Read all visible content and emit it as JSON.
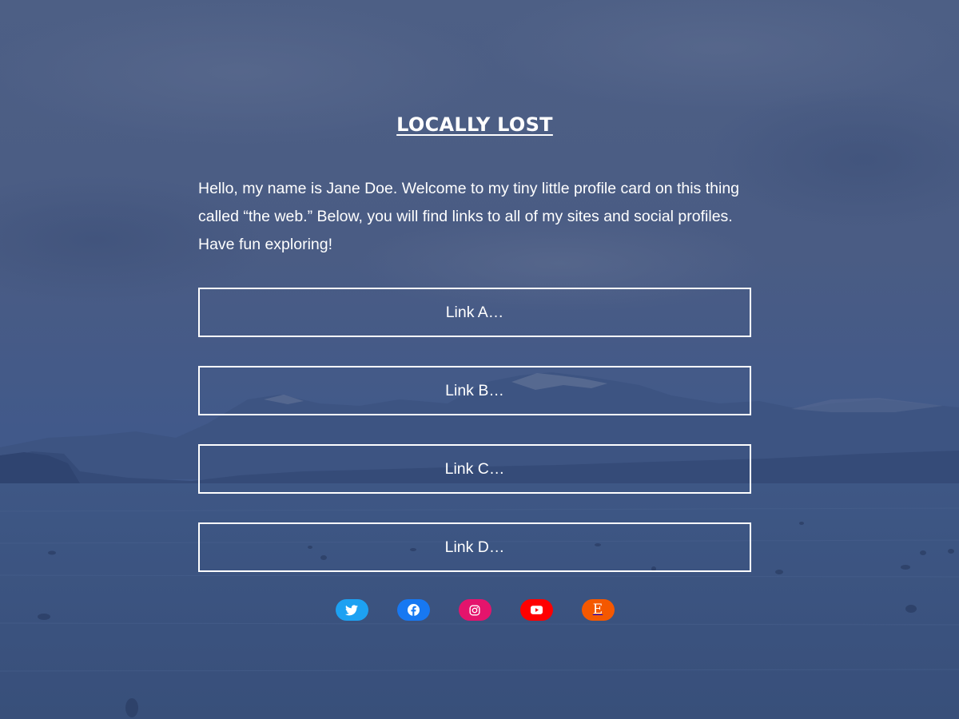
{
  "site": {
    "title": "LOCALLY LOST"
  },
  "intro": {
    "text": "Hello, my name is Jane Doe. Welcome to my tiny little profile card on this thing called “the web.” Below, you will find links to all of my sites and social profiles. Have fun exploring!"
  },
  "links": [
    {
      "label": "Link A…"
    },
    {
      "label": "Link B…"
    },
    {
      "label": "Link C…"
    },
    {
      "label": "Link D…"
    }
  ],
  "socials": [
    {
      "icon": "twitter-icon",
      "color": "#1da1f2"
    },
    {
      "icon": "facebook-icon",
      "color": "#1778f2"
    },
    {
      "icon": "instagram-icon",
      "color": "#e4146c"
    },
    {
      "icon": "youtube-icon",
      "color": "#ff0000"
    },
    {
      "icon": "etsy-icon",
      "glyph": "E",
      "color": "#f45800"
    }
  ],
  "theme": {
    "overlay_color": "#3a5586",
    "text_color": "#ffffff"
  }
}
